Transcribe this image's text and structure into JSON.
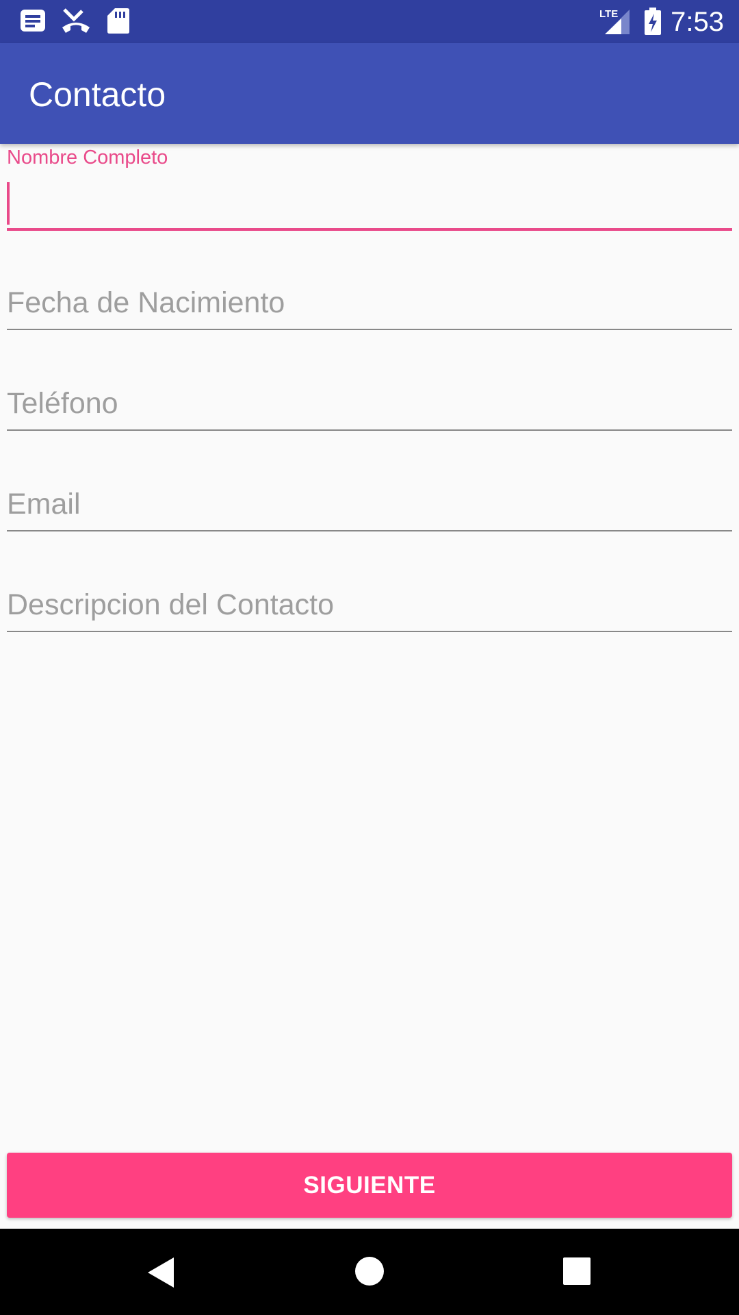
{
  "status_bar": {
    "time": "7:53",
    "network_label": "LTE",
    "icons": [
      "notes-icon",
      "missed-call-icon",
      "sd-card-icon",
      "lte-signal-icon",
      "battery-charging-icon"
    ]
  },
  "app_bar": {
    "title": "Contacto"
  },
  "form": {
    "full_name": {
      "label": "Nombre Completo",
      "value": ""
    },
    "birth_date": {
      "placeholder": "Fecha de Nacimiento"
    },
    "phone": {
      "placeholder": "Teléfono"
    },
    "email": {
      "placeholder": "Email"
    },
    "description": {
      "placeholder": "Descripcion del Contacto"
    }
  },
  "next_button": {
    "label": "SIGUIENTE"
  },
  "colors": {
    "status_bar": "#303f9f",
    "app_bar": "#3f51b5",
    "accent": "#ff4081",
    "focus_label": "#e94a8a",
    "background": "#fafafa"
  },
  "nav_bar": {
    "icons": [
      "back-icon",
      "home-icon",
      "recents-icon"
    ]
  }
}
